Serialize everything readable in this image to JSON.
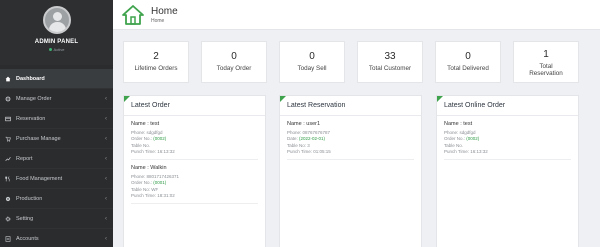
{
  "sidebar": {
    "admin_title": "ADMIN PANEL",
    "status_text": "Active",
    "items": [
      {
        "label": "Dashboard",
        "icon": "home-icon",
        "arrow": ""
      },
      {
        "label": "Manage Order",
        "icon": "gear-icon",
        "arrow": "‹"
      },
      {
        "label": "Reservation",
        "icon": "reservation-icon",
        "arrow": "‹"
      },
      {
        "label": "Purchase Manage",
        "icon": "cart-icon",
        "arrow": "‹"
      },
      {
        "label": "Report",
        "icon": "report-icon",
        "arrow": "‹"
      },
      {
        "label": "Food Management",
        "icon": "food-icon",
        "arrow": "‹"
      },
      {
        "label": "Production",
        "icon": "production-icon",
        "arrow": "‹"
      },
      {
        "label": "Setting",
        "icon": "settings-icon",
        "arrow": "‹"
      },
      {
        "label": "Accounts",
        "icon": "accounts-icon",
        "arrow": "‹"
      }
    ]
  },
  "header": {
    "title": "Home",
    "breadcrumb": "Home"
  },
  "stats": [
    {
      "value": "2",
      "label": "Lifetime Orders"
    },
    {
      "value": "0",
      "label": "Today Order"
    },
    {
      "value": "0",
      "label": "Today Sell"
    },
    {
      "value": "33",
      "label": "Total Customer"
    },
    {
      "value": "0",
      "label": "Total Delivered"
    },
    {
      "value": "1",
      "label": "Total Reservation"
    }
  ],
  "latest_order": {
    "title": "Latest Order",
    "entries": [
      {
        "name": "Name : test",
        "phone": "Phone: sdgdfgd",
        "order_prefix": "Order No.: ",
        "order_no": "(0002)",
        "table": "Table No.",
        "punch": "Punch Time: 16:13:32"
      },
      {
        "name": "Name : Walkin",
        "phone": "Phone: 8801717426371",
        "order_prefix": "Order No.: ",
        "order_no": "(0001)",
        "table": "Table No: WF",
        "punch": "Punch Time: 18:31:02"
      }
    ]
  },
  "latest_reservation": {
    "title": "Latest Reservation",
    "entries": [
      {
        "name": "Name : user1",
        "phone": "Phone: 08767676787",
        "date_prefix": "Date: ",
        "date": "(2022-02-01)",
        "table": "Table No: 3",
        "punch": "Punch Time: 01:05:15"
      }
    ]
  },
  "latest_online_order": {
    "title": "Latest Online Order",
    "entries": [
      {
        "name": "Name : test",
        "phone": "Phone: sdgdfgd",
        "order_prefix": "Order No.: ",
        "order_no": "(0002)",
        "table": "Table No.",
        "punch": "Punch Time: 16:13:32"
      }
    ]
  },
  "colors": {
    "sidebar_bg": "#2a2c2e",
    "accent_green": "#3fa34d",
    "status_green": "#3cb371"
  }
}
